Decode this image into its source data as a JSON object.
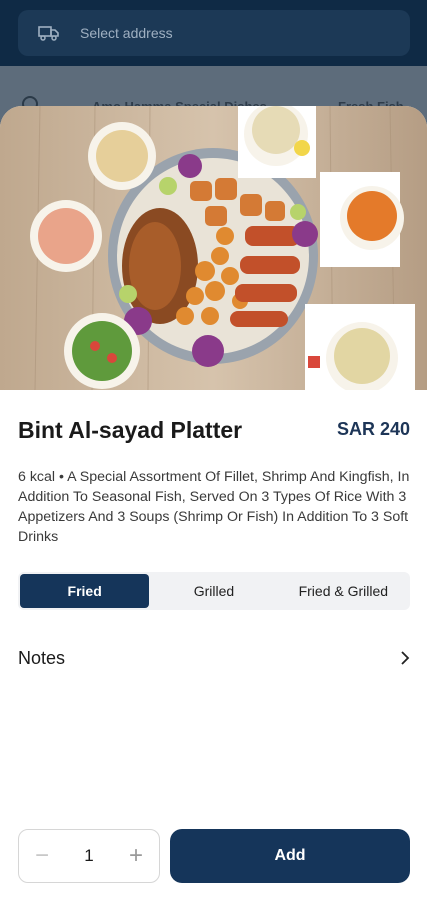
{
  "header": {
    "address_placeholder": "Select address",
    "categories": [
      "Amo Hamma Special Dishes",
      "Fresh Fish"
    ]
  },
  "item": {
    "name": "Bint Al-sayad Platter",
    "price": "SAR 240",
    "description": "6 kcal • A Special Assortment Of Fillet, Shrimp And Kingfish, In Addition To Seasonal Fish, Served On 3 Types Of Rice With 3 Appetizers And 3 Soups (Shrimp Or Fish) In Addition To 3 Soft Drinks"
  },
  "options": [
    {
      "label": "Fried",
      "selected": true
    },
    {
      "label": "Grilled",
      "selected": false
    },
    {
      "label": "Fried & Grilled",
      "selected": false
    }
  ],
  "notes": {
    "label": "Notes",
    "icon": "chevron-right-icon"
  },
  "cart": {
    "quantity": "1",
    "minus_symbol": "−",
    "plus_symbol": "+",
    "add_label": "Add"
  },
  "colors": {
    "primary": "#15355a",
    "price": "#1d3557"
  }
}
